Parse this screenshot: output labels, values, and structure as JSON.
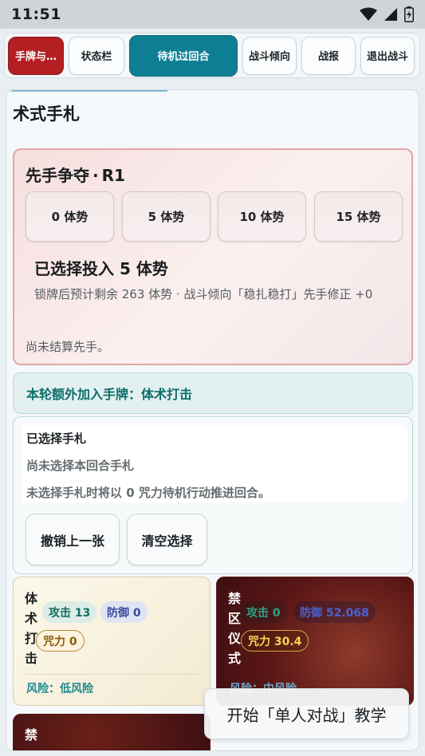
{
  "status_bar": {
    "time": "11:51"
  },
  "tabs": [
    {
      "label": "手牌与…"
    },
    {
      "label": "状态栏"
    },
    {
      "label": "待机过回合"
    },
    {
      "label": "战斗倾向"
    },
    {
      "label": "战报"
    },
    {
      "label": "退出战斗"
    }
  ],
  "panel": {
    "title": "术式手札"
  },
  "initiative": {
    "title_main": "先手争夺",
    "title_sep": "·",
    "title_round": "R1",
    "options": [
      "0 体势",
      "5 体势",
      "10 体势",
      "15 体势"
    ],
    "selected_text": "已选择投入 5 体势",
    "desc": "锁牌后预计剩余 263 体势 · 战斗倾向「稳扎稳打」先手修正 +0",
    "note": "尚未结算先手。"
  },
  "extra_notice": "本轮额外加入手牌：体术打击",
  "selected_box": {
    "title": "已选择手札",
    "line1": "尚未选择本回合手札",
    "line2": "未选择手札时将以 0 咒力待机行动推进回合。",
    "undo_label": "撤销上一张",
    "clear_label": "清空选择"
  },
  "cards": [
    {
      "name": "体术打击",
      "attack": "攻击 13",
      "defense": "防御 0",
      "power": "咒力 0",
      "risk": "风险：低风险"
    },
    {
      "name": "禁区仪式",
      "attack": "攻击 0",
      "defense": "防御 52.068",
      "power": "咒力 30.4",
      "risk": "风险：中风险"
    }
  ],
  "card_partial": {
    "name": "禁"
  },
  "toast": "开始「单人对战」教学",
  "colors": {
    "accent_teal": "#0e7f93",
    "accent_red": "#b31f23"
  }
}
